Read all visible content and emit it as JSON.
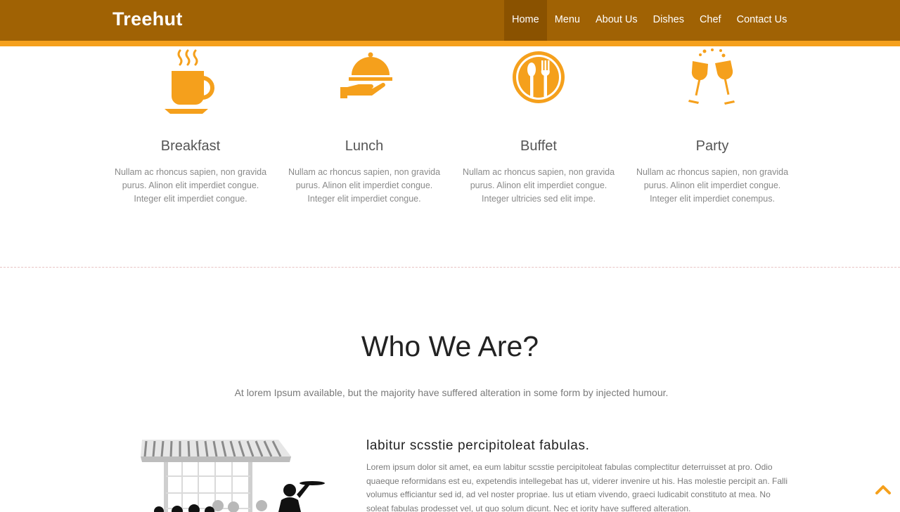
{
  "brand": "Treehut",
  "colors": {
    "header_bg": "#a06204",
    "accent": "#f5a01c",
    "active_nav_bg": "#8a5200"
  },
  "nav": {
    "items": [
      {
        "label": "Home",
        "active": true
      },
      {
        "label": "Menu"
      },
      {
        "label": "About Us"
      },
      {
        "label": "Dishes"
      },
      {
        "label": "Chef"
      },
      {
        "label": "Contact Us"
      }
    ]
  },
  "services": [
    {
      "icon": "coffee-cup-icon",
      "title": "Breakfast",
      "text": "Nullam ac rhoncus sapien, non gravida purus. Alinon elit imperdiet congue. Integer elit imperdiet congue."
    },
    {
      "icon": "cloche-serving-icon",
      "title": "Lunch",
      "text": "Nullam ac rhoncus sapien, non gravida purus. Alinon elit imperdiet congue. Integer elit imperdiet congue."
    },
    {
      "icon": "plate-cutlery-icon",
      "title": "Buffet",
      "text": "Nullam ac rhoncus sapien, non gravida purus. Alinon elit imperdiet congue. Integer ultricies sed elit impe."
    },
    {
      "icon": "wine-glasses-icon",
      "title": "Party",
      "text": "Nullam ac rhoncus sapien, non gravida purus. Alinon elit imperdiet congue. Integer elit imperdiet conempus."
    }
  ],
  "who_we_are": {
    "title": "Who We Are?",
    "subtitle": "At lorem Ipsum available, but the majority have suffered alteration in some form by injected humour.",
    "heading": "labitur scsstie percipitoleat fabulas.",
    "body": "Lorem ipsum dolor sit amet, ea eum labitur scsstie percipitoleat fabulas complectitur deterruisset at pro. Odio quaeque reformidans est eu, expetendis intellegebat has ut, viderer invenire ut his. Has molestie percipit an. Falli volumus efficiantur sed id, ad vel noster propriae. Ius ut etiam vivendo, graeci ludicabit constituto at mea. No soleat fabulas prodesset vel, ut quo solum dicunt. Nec et iority have suffered alteration."
  },
  "back_to_top_icon": "chevron-up-icon"
}
